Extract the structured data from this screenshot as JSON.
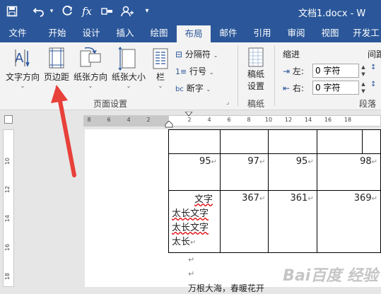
{
  "title_bar": {
    "doc_title": "文档1.docx  -  W",
    "icons": [
      "save-icon",
      "undo-icon",
      "redo-icon",
      "function-icon",
      "format-icon",
      "add-user-icon",
      "dropdown-icon"
    ]
  },
  "tabs": [
    {
      "label": "文件",
      "active": false
    },
    {
      "label": "开始",
      "active": false
    },
    {
      "label": "设计",
      "active": false
    },
    {
      "label": "插入",
      "active": false
    },
    {
      "label": "绘图",
      "active": false
    },
    {
      "label": "布局",
      "active": true
    },
    {
      "label": "邮件",
      "active": false
    },
    {
      "label": "引用",
      "active": false
    },
    {
      "label": "审阅",
      "active": false
    },
    {
      "label": "视图",
      "active": false
    },
    {
      "label": "开发工",
      "active": false
    }
  ],
  "ribbon": {
    "page_setup": {
      "text_direction": "文字方向",
      "margins": "页边距",
      "orientation": "纸张方向",
      "size": "纸张大小",
      "columns": "栏",
      "breaks": "分隔符",
      "line_numbers": "行号",
      "hyphenation": "断字",
      "group_label": "页面设置"
    },
    "manuscript": {
      "button": "稿纸\n设置",
      "btn_line1": "稿纸",
      "btn_line2": "设置",
      "group_label": "稿纸"
    },
    "paragraph": {
      "indent_title": "缩进",
      "spacing_title": "间距",
      "left_label": "左:",
      "left_value": "0 字符",
      "right_label": "右:",
      "right_value": "0 字符",
      "group_label": "段落"
    }
  },
  "ruler": {
    "h_ticks": [
      "8",
      "6",
      "4",
      "2",
      "",
      "2",
      "4",
      "6",
      "8",
      "10",
      "12",
      "14",
      "16",
      "18"
    ],
    "v_ticks": [
      "10",
      "12",
      "14",
      "16",
      "18"
    ]
  },
  "document": {
    "rows": [
      {
        "cells": [
          "",
          "",
          "",
          "",
          ""
        ]
      },
      {
        "cells": [
          "95",
          "97",
          "95",
          "98"
        ]
      },
      {
        "cells": [
          "367",
          "361",
          "369"
        ],
        "first_lines": [
          "文字",
          "太长文字",
          "太长文字",
          "太长"
        ]
      }
    ],
    "footer_text": "万根大海，春暖花开"
  },
  "colors": {
    "accent": "#2b579a",
    "arrow": "#e8403a"
  }
}
